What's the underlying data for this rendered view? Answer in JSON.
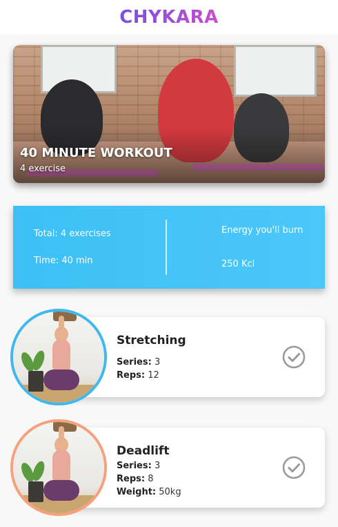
{
  "header": {
    "brand": "CHYKARA"
  },
  "hero": {
    "title": "40 MINUTE WORKOUT",
    "subtitle": "4 exercise"
  },
  "summary": {
    "total": "Total: 4 exercises",
    "time": "Time: 40 min",
    "energy_label": "Energy you'll burn",
    "energy_value": "250 Kcl"
  },
  "exercises": [
    {
      "name": "Stretching",
      "stats": [
        {
          "label": "Series:",
          "value": "3"
        },
        {
          "label": "Reps:",
          "value": "12"
        }
      ],
      "ring_color": "#3fb8ef"
    },
    {
      "name": "Deadlift",
      "stats": [
        {
          "label": "Series:",
          "value": "3"
        },
        {
          "label": "Reps:",
          "value": "8"
        },
        {
          "label": "Weight:",
          "value": "50kg"
        }
      ],
      "ring_color": "#f7a07c"
    }
  ],
  "colors": {
    "brand_start": "#7b4fe0",
    "brand_end": "#c94fd0",
    "summary_bg": "#3cc0f5",
    "check_icon": "#9a9a9a"
  }
}
